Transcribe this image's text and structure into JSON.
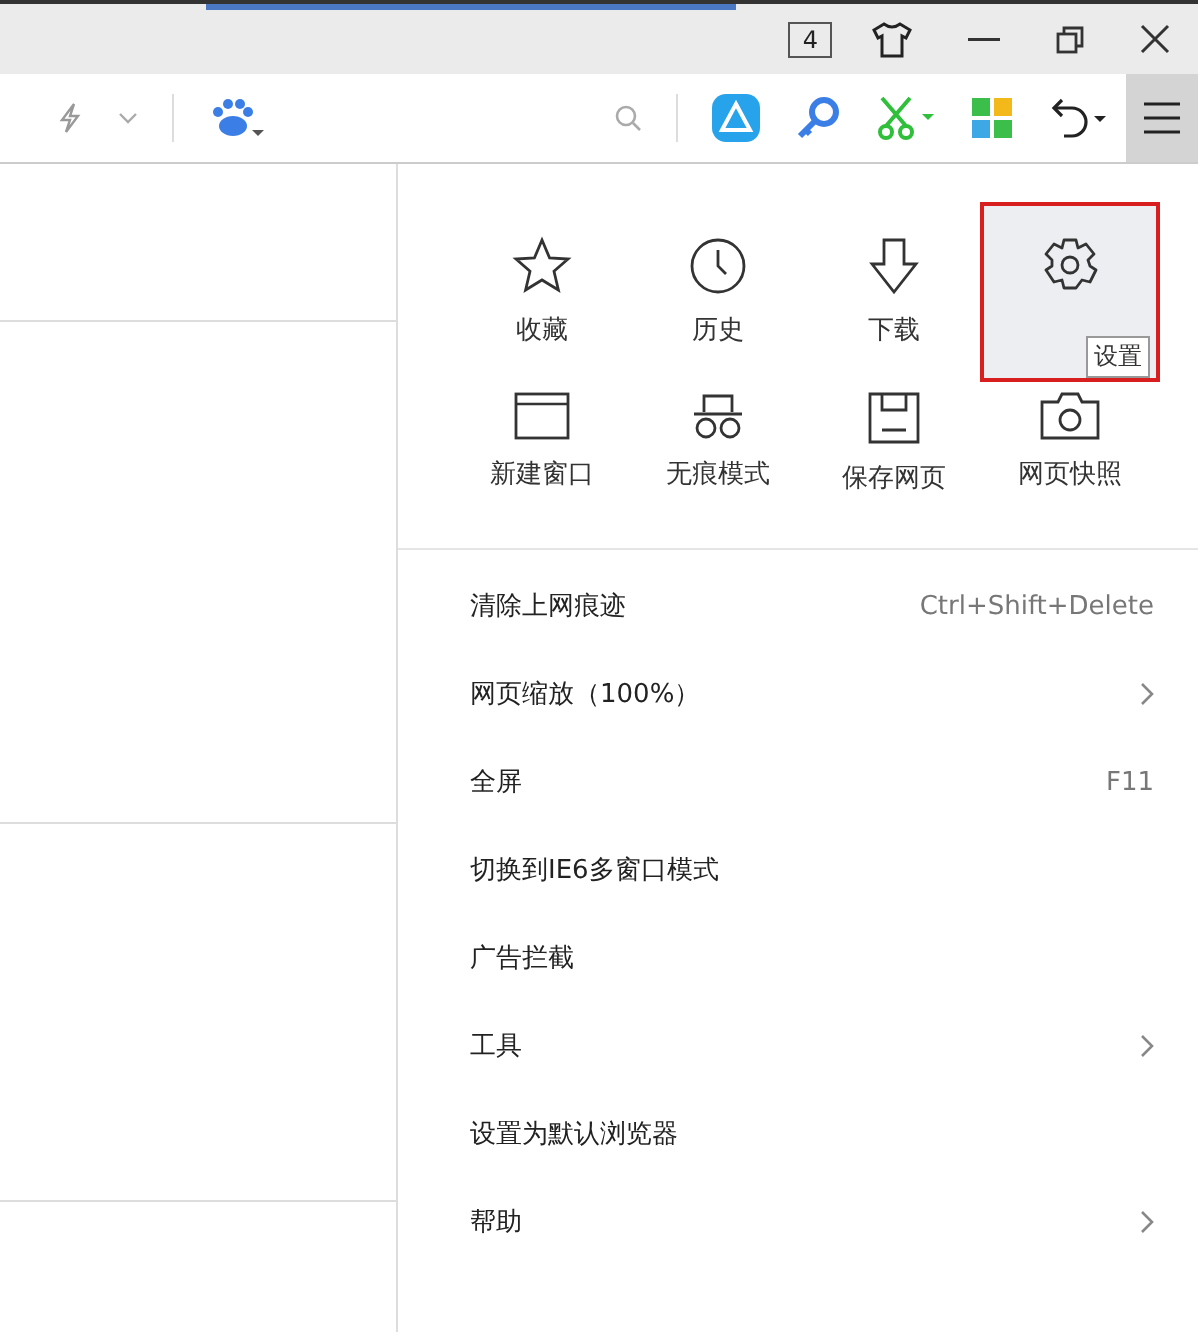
{
  "titlebar": {
    "tab_count": "4"
  },
  "toolbar": {
    "menu_open": true
  },
  "menu": {
    "grid": [
      {
        "kind": "star",
        "label": "收藏",
        "highlighted": false
      },
      {
        "kind": "clock",
        "label": "历史",
        "highlighted": false
      },
      {
        "kind": "download",
        "label": "下载",
        "highlighted": false
      },
      {
        "kind": "gear",
        "highlighted": true,
        "tooltip": "设置"
      },
      {
        "kind": "window",
        "label": "新建窗口",
        "highlighted": false
      },
      {
        "kind": "glasses",
        "label": "无痕模式",
        "highlighted": false
      },
      {
        "kind": "save",
        "label": "保存网页",
        "highlighted": false
      },
      {
        "kind": "camera",
        "label": "网页快照",
        "highlighted": false
      }
    ],
    "items": [
      {
        "label": "清除上网痕迹",
        "shortcut": "Ctrl+Shift+Delete",
        "submenu": false
      },
      {
        "label": "网页缩放（100%）",
        "submenu": true
      },
      {
        "label": "全屏",
        "shortcut": "F11",
        "submenu": false
      },
      {
        "label": "切换到IE6多窗口模式",
        "submenu": false
      },
      {
        "label": "广告拦截",
        "submenu": false
      },
      {
        "label": "工具",
        "submenu": true
      },
      {
        "label": "设置为默认浏览器",
        "submenu": false
      },
      {
        "label": "帮助",
        "submenu": true
      }
    ]
  }
}
